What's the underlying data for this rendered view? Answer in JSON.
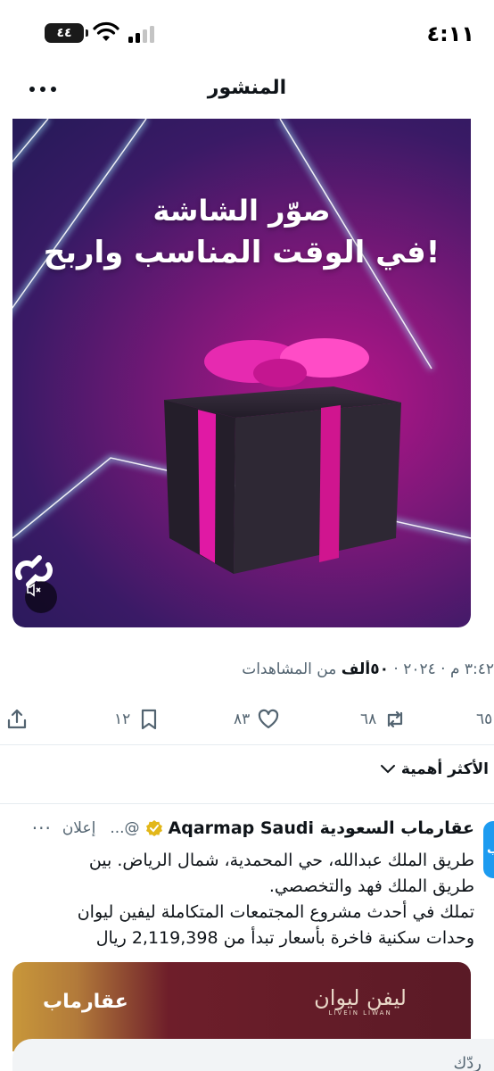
{
  "status_bar": {
    "time": "٤:١١",
    "battery": "٤٤"
  },
  "header": {
    "title": "المنشور"
  },
  "media": {
    "line1": "صوّر الشاشة",
    "line2": "في الوقت المناسب واربح!"
  },
  "meta": {
    "timestamp": "٣:٤٢ م · ٢٠٢٤",
    "views_count": "٥٠ألف",
    "views_label": "من المشاهدات"
  },
  "actions": {
    "replies": "٦٥",
    "retweets": "٦٨",
    "likes": "٨٣",
    "bookmarks": "١٢"
  },
  "sort": {
    "label": "الأكثر أهمية"
  },
  "ad": {
    "avatar_letter": "ب",
    "name": "عقارماب السعودية Aqarmap Saudi",
    "handle": "@...",
    "label": "إعلان",
    "more": "···",
    "text_line1": "طريق الملك عبدالله، حي المحمدية، شمال الرياض. بين",
    "text_line2": "طريق الملك فهد والتخصصي.",
    "text_line3": "تملك في أحدث مشروع المجتمعات المتكاملة ليفين ليوان",
    "text_line4": "وحدات سكنية فاخرة بأسعار تبدأ من 2,119,398 ريال",
    "image_logo_left": "عقارماب",
    "image_logo_right": "ليفن ليوان",
    "image_logo_right_en": "LIVEIN LIWAN"
  },
  "reply": {
    "placeholder": "ردّك"
  },
  "colors": {
    "accent": "#1d9bf0",
    "text": "#0f1419",
    "muted": "#536471"
  }
}
